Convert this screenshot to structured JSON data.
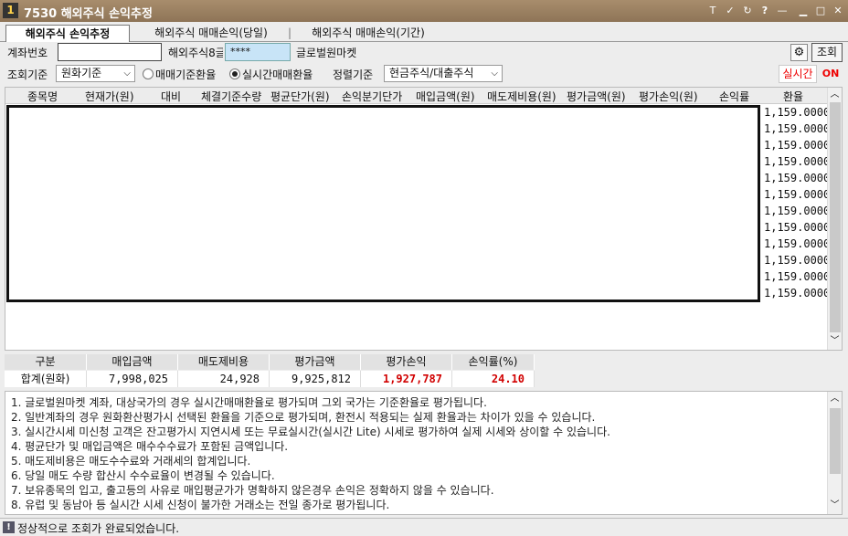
{
  "window": {
    "number": "1",
    "title": "7530 해외주식 손익추정",
    "controls": [
      "T",
      "✓",
      "↻",
      "?",
      "—",
      "▁",
      "□",
      "✕"
    ]
  },
  "tabs": [
    {
      "label": "해외주식 손익추정",
      "active": true
    },
    {
      "label": "해외주식 매매손익(당일)",
      "active": false
    },
    {
      "label": "해외주식 매매손익(기간)",
      "active": false
    }
  ],
  "tab_separator": "|",
  "form": {
    "account_label": "계좌번호",
    "account_value": "",
    "password_label": "해외주식8글",
    "password_value": "****",
    "market_label": "글로벌원마켓",
    "search_button": "조회",
    "query_basis_label": "조회기준",
    "query_basis_value": "원화기준",
    "radio_trade_rate": "매매기준환율",
    "radio_realtime_rate": "실시간매매환율",
    "sort_label": "정렬기준",
    "sort_value": "현금주식/대출주식",
    "realtime_label": "실시간",
    "realtime_toggle": "ON"
  },
  "grid": {
    "headers": [
      "종목명",
      "현재가(원)",
      "대비",
      "체결기준수량",
      "평균단가(원)",
      "손익분기단가",
      "매입금액(원)",
      "매도제비용(원)",
      "평가금액(원)",
      "평가손익(원)",
      "손익률",
      "환율"
    ],
    "rates": [
      "1,159.0000",
      "1,159.0000",
      "1,159.0000",
      "1,159.0000",
      "1,159.0000",
      "1,159.0000",
      "1,159.0000",
      "1,159.0000",
      "1,159.0000",
      "1,159.0000",
      "1,159.0000",
      "1,159.0000"
    ]
  },
  "summary": {
    "headers": [
      "구분",
      "매입금액",
      "매도제비용",
      "평가금액",
      "평가손익",
      "손익률(%)"
    ],
    "row": [
      "합계(원화)",
      "7,998,025",
      "24,928",
      "9,925,812",
      "1,927,787",
      "24.10"
    ]
  },
  "notes": [
    "1. 글로벌원마켓 계좌, 대상국가의 경우 실시간매매환율로 평가되며 그외 국가는 기준환율로 평가됩니다.",
    "2. 일반계좌의 경우 원화환산평가시 선택된 환율을 기준으로 평가되며, 환전시 적용되는 실제 환율과는 차이가 있을 수 있습니다.",
    "3. 실시간시세 미신청 고객은 잔고평가시 지연시세 또는 무료실시간(실시간 Lite) 시세로 평가하여 실제 시세와 상이할 수 있습니다.",
    "4. 평균단가 및 매입금액은 매수수수료가 포함된 금액입니다.",
    "5. 매도제비용은 매도수수료와 거래세의 합계입니다.",
    "6. 당일 매도 수량 합산시 수수료율이 변경될 수 있습니다.",
    "7. 보유종목의 입고, 출고등의 사유로 매입평균가가 명확하지 않은경우 손익은 정확하지 않을 수 있습니다.",
    "8. 유럽 및 동남아 등 실시간 시세 신청이 불가한 거래소는 전일 종가로 평가됩니다."
  ],
  "status": {
    "icon": "!",
    "message": "정상적으로 조회가 완료되었습니다."
  }
}
